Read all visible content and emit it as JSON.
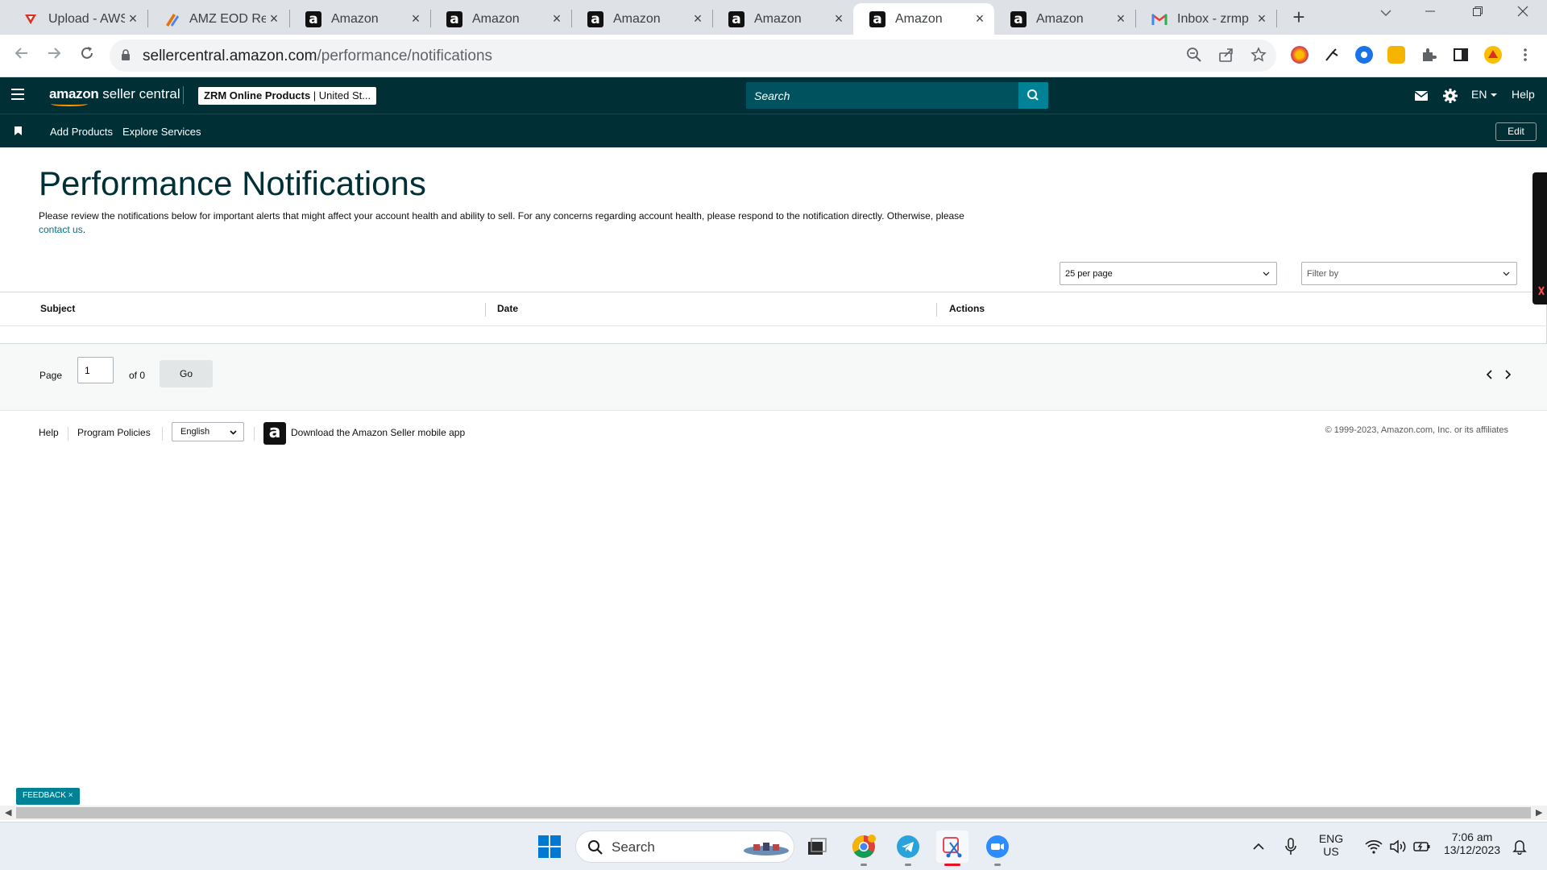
{
  "browser": {
    "tabs": [
      {
        "title": "Upload - AWS",
        "favicon": "aws-upload-icon",
        "active": false
      },
      {
        "title": "AMZ EOD Report",
        "favicon": "eod-report-icon",
        "active": false
      },
      {
        "title": "Amazon",
        "favicon": "amazon-icon",
        "active": false
      },
      {
        "title": "Amazon",
        "favicon": "amazon-icon",
        "active": false
      },
      {
        "title": "Amazon",
        "favicon": "amazon-icon",
        "active": false
      },
      {
        "title": "Amazon",
        "favicon": "amazon-icon",
        "active": false
      },
      {
        "title": "Amazon",
        "favicon": "amazon-icon",
        "active": true
      },
      {
        "title": "Amazon",
        "favicon": "amazon-icon",
        "active": false
      },
      {
        "title": "Inbox - zrmp",
        "favicon": "gmail-icon",
        "active": false
      }
    ],
    "url_host": "sellercentral.amazon.com",
    "url_path": "/performance/notifications"
  },
  "header": {
    "logo_brand": "amazon",
    "logo_product": "seller central",
    "store_name": "ZRM Online Products",
    "store_region": "United St...",
    "search_placeholder": "Search",
    "language": "EN",
    "help": "Help"
  },
  "subnav": {
    "links": [
      "Add Products",
      "Explore Services"
    ],
    "edit": "Edit"
  },
  "main": {
    "title": "Performance Notifications",
    "intro_text": "Please review the notifications below for important alerts that might affect your account health and ability to sell. For any concerns regarding account health, please respond to the notification directly. Otherwise, please",
    "intro_link": "contact us",
    "intro_end": ".",
    "per_page": "25 per page",
    "filter_placeholder": "Filter by",
    "columns": [
      "Subject",
      "Date",
      "Actions"
    ]
  },
  "pager": {
    "page_label": "Page",
    "page_value": "1",
    "of_label": "of 0",
    "go": "Go"
  },
  "footer": {
    "help": "Help",
    "policies": "Program Policies",
    "language": "English",
    "app_text": "Download the Amazon Seller mobile app",
    "copyright": "© 1999-2023, Amazon.com, Inc. or its affiliates"
  },
  "feedback": {
    "label": "FEEDBACK",
    "close": "×"
  },
  "taskbar": {
    "search": "Search",
    "lang_top": "ENG",
    "lang_bottom": "US",
    "time": "7:06 am",
    "date": "13/12/2023"
  },
  "colors": {
    "header_bg": "#002f36",
    "accent": "#008296",
    "link": "#007185",
    "title": "#002f36"
  }
}
